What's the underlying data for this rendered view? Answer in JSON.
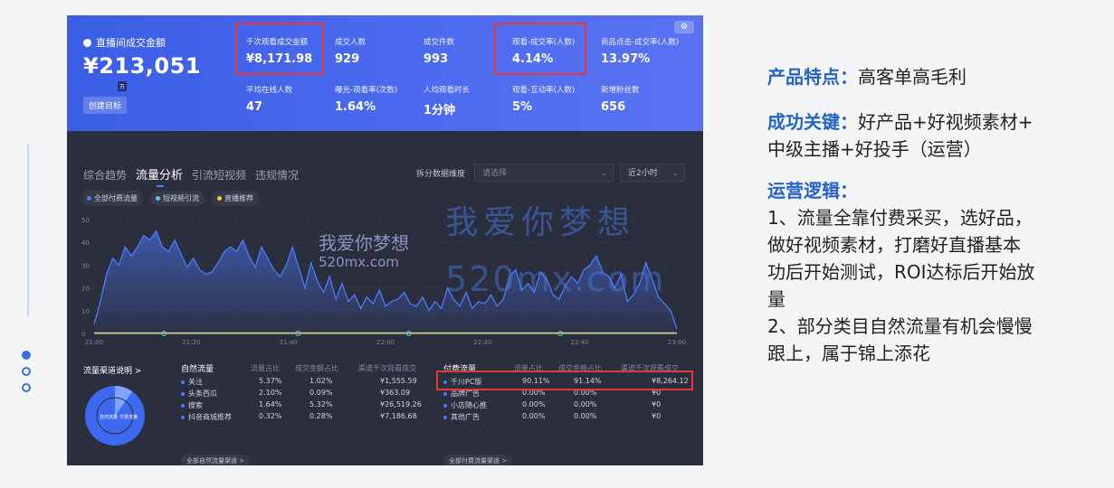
{
  "dashboard": {
    "gmv_label": "直播间成交金额",
    "gmv_value": "¥213,051",
    "gmv_unit": "万",
    "goal_button": "创建目标",
    "metrics": [
      {
        "label": "千次观看成交金额",
        "value": "¥8,171.98"
      },
      {
        "label": "成交人数",
        "value": "929"
      },
      {
        "label": "成交件数",
        "value": "993"
      },
      {
        "label": "观看-成交率(人数)",
        "value": "4.14%"
      },
      {
        "label": "商品点击-成交率(人数)",
        "value": "13.97%"
      },
      {
        "label": "平均在线人数",
        "value": "47"
      },
      {
        "label": "曝光-观看率(次数)",
        "value": "1.64%"
      },
      {
        "label": "人均观看时长",
        "value": "1分钟"
      },
      {
        "label": "观看-互动率(人数)",
        "value": "5%"
      },
      {
        "label": "新增粉丝数",
        "value": "656"
      }
    ],
    "tabs": [
      "综合趋势",
      "流量分析",
      "引流短视频",
      "违规情况"
    ],
    "active_tab": 1,
    "dimension_label": "拆分数据维度",
    "select_placeholder": "请选择",
    "time_range": "近2小时",
    "legend": [
      {
        "name": "全部付费流量",
        "color": "#4a7bff"
      },
      {
        "name": "短视频引流",
        "color": "#59c3f5"
      },
      {
        "name": "直播推荐",
        "color": "#f2c94c"
      }
    ],
    "watermarks": [
      "我爱你梦想",
      "520mx.com",
      "我爱你梦想",
      "520mx.com"
    ]
  },
  "chart_data": {
    "type": "area",
    "x_ticks": [
      "21:00",
      "21:20",
      "21:40",
      "22:00",
      "22:20",
      "22:40",
      "23:00"
    ],
    "y_ticks": [
      0,
      10,
      20,
      30,
      40,
      50
    ],
    "ylim": [
      0,
      50
    ],
    "series": [
      {
        "name": "全部付费流量",
        "color": "#4a7bff",
        "values": [
          4,
          14,
          26,
          33,
          30,
          38,
          34,
          38,
          43,
          41,
          45,
          38,
          36,
          41,
          35,
          29,
          33,
          28,
          26,
          27,
          31,
          36,
          38,
          36,
          41,
          34,
          29,
          38,
          33,
          28,
          25,
          30,
          38,
          29,
          20,
          31,
          23,
          18,
          25,
          15,
          22,
          14,
          17,
          11,
          16,
          13,
          19,
          12,
          14,
          15,
          18,
          13,
          12,
          16,
          10,
          14,
          11,
          20,
          15,
          12,
          18,
          11,
          14,
          13,
          17,
          12,
          15,
          25,
          28,
          19,
          22,
          18,
          27,
          24,
          17,
          15,
          21,
          25,
          22,
          28,
          30,
          34,
          27,
          25,
          20,
          26,
          14,
          17,
          22,
          31,
          24,
          16,
          13,
          10,
          2
        ]
      },
      {
        "name": "短视频引流",
        "color": "#59c3f5",
        "values": [
          0,
          0,
          0,
          0,
          0,
          0,
          0,
          0,
          0,
          0,
          0,
          0,
          0,
          0,
          0,
          0,
          0,
          0,
          0,
          0,
          0,
          0,
          0,
          0,
          0,
          0,
          0,
          0,
          0,
          0,
          0,
          0,
          0,
          0,
          0,
          0,
          0,
          0,
          0,
          0,
          0,
          0,
          0,
          0,
          0,
          0,
          0,
          0,
          0,
          0,
          0,
          0,
          0,
          0,
          0,
          0,
          0,
          0,
          0,
          0,
          0,
          0,
          0,
          0,
          0,
          0,
          0,
          0,
          0,
          0,
          0,
          0,
          0,
          0,
          0,
          0,
          0,
          0,
          0,
          0,
          0,
          0,
          0,
          0,
          0,
          0,
          0,
          0,
          0,
          0,
          0,
          0,
          0,
          0,
          0
        ]
      },
      {
        "name": "直播推荐",
        "color": "#f2c94c",
        "values": [
          0,
          0,
          0,
          0,
          0,
          0,
          0,
          0,
          0,
          0,
          0,
          0,
          0,
          0,
          0,
          0,
          0,
          0,
          0,
          0,
          0,
          0,
          0,
          0,
          0,
          0,
          0,
          0,
          0,
          0,
          0,
          0,
          0,
          0,
          0,
          0,
          0,
          0,
          0,
          0,
          0,
          0,
          0,
          0,
          0,
          0,
          0,
          0,
          0,
          0,
          0,
          0,
          0,
          0,
          0,
          0,
          0,
          0,
          0,
          0,
          0,
          0,
          0,
          0,
          0,
          0,
          0,
          0,
          0,
          0,
          0,
          0,
          0,
          0,
          0,
          0,
          0,
          0,
          0,
          0,
          0,
          0,
          0,
          0,
          0,
          0,
          0,
          0,
          0,
          0,
          0,
          0,
          0,
          0,
          0
        ]
      }
    ]
  },
  "channels": {
    "title": "流量渠道说明 >",
    "pie_labels": [
      "自然流量",
      "付费流量"
    ],
    "pie_shares": [
      0.1,
      0.9
    ],
    "natural": {
      "headers": [
        "自然流量",
        "流量占比",
        "成交金额占比",
        "渠道千次观看成交"
      ],
      "rows": [
        [
          "关注",
          "5.37%",
          "1.02%",
          "¥1,555.59"
        ],
        [
          "头条西瓜",
          "2.10%",
          "0.09%",
          "¥363.09"
        ],
        [
          "搜索",
          "1.64%",
          "5.32%",
          "¥26,519.26"
        ],
        [
          "抖音商城推荐",
          "0.32%",
          "0.28%",
          "¥7,186.68"
        ]
      ],
      "more": "全部自然流量渠道 >"
    },
    "paid": {
      "headers": [
        "付费流量",
        "流量占比",
        "成交金额占比",
        "渠道千次观看成交"
      ],
      "rows": [
        [
          "千川PC版",
          "90.11%",
          "91.14%",
          "¥8,264.12"
        ],
        [
          "品牌广告",
          "0.00%",
          "0.00%",
          "¥0"
        ],
        [
          "小店随心推",
          "0.00%",
          "0.00%",
          "¥0"
        ],
        [
          "其他广告",
          "0.00%",
          "0.00%",
          "¥0"
        ]
      ],
      "more": "全部付费流量渠道 >"
    }
  },
  "notes": {
    "feature_key": "产品特点：",
    "feature_text": "高客单高毛利",
    "key_key": "成功关键：",
    "key_text_1": "好产品+好视频素材+",
    "key_text_2": "中级主播+好投手（运营）",
    "logic_key": "运营逻辑：",
    "logic_lines": [
      "1、流量全靠付费采买，选好品，",
      "做好视频素材，打磨好直播基本",
      "功后开始测试，ROI达标后开始放",
      "量",
      "2、部分类目自然流量有机会慢慢",
      "跟上，属于锦上添花"
    ]
  },
  "colors": {
    "accent": "#3a5ee4",
    "highlight": "#e5383b",
    "note_key": "#2563c9"
  }
}
